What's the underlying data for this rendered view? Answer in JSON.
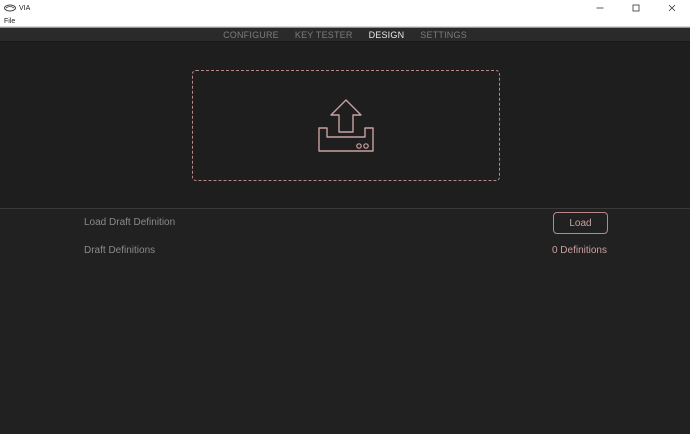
{
  "window": {
    "title": "VIA",
    "icons": {
      "app": "via-logo-icon",
      "minimize": "minimize-icon",
      "maximize": "maximize-icon",
      "close": "close-icon"
    }
  },
  "menu": {
    "items": [
      {
        "label": "File"
      }
    ]
  },
  "nav": {
    "tabs": [
      {
        "label": "CONFIGURE",
        "active": false
      },
      {
        "label": "KEY TESTER",
        "active": false
      },
      {
        "label": "DESIGN",
        "active": true
      },
      {
        "label": "SETTINGS",
        "active": false
      }
    ]
  },
  "dropzone": {
    "icon": "upload-tray-icon"
  },
  "design": {
    "load_draft_label": "Load Draft Definition",
    "load_button": "Load",
    "draft_definitions_label": "Draft Definitions",
    "definitions_count": "0 Definitions"
  },
  "colors": {
    "accent": "#b9878a",
    "background": "#1f1f1f",
    "nav_background": "#2a2a2a",
    "text_muted": "#8a8a8a",
    "text_active": "#e8e8e8"
  }
}
